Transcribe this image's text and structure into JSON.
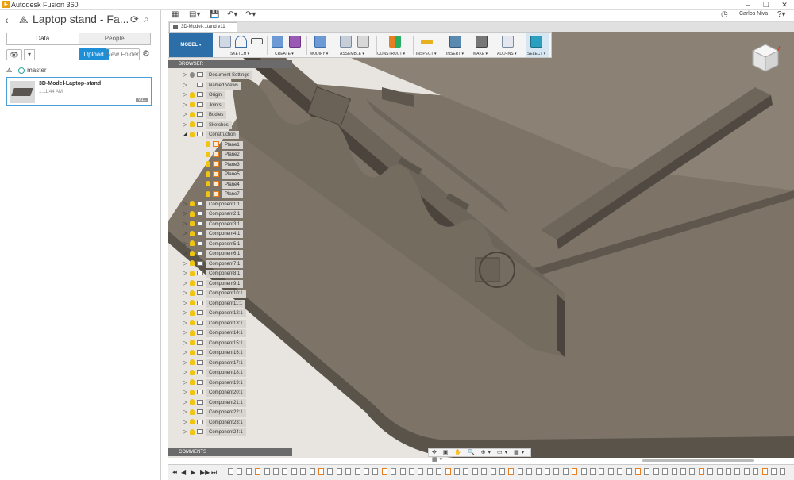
{
  "window": {
    "app_title": "Autodesk Fusion 360",
    "logo": "F",
    "min_glyph": "–",
    "max_glyph": "❐",
    "close_glyph": "✕"
  },
  "data_panel": {
    "title": "Laptop stand - Fa...",
    "tabs": [
      "Data",
      "People"
    ],
    "upload_label": "Upload",
    "new_folder_label": "New Folder",
    "branch": "master",
    "file": {
      "name": "3D-Model-Laptop-stand",
      "time": "1:11:44 AM",
      "version": "V11"
    }
  },
  "appbar": {
    "user": "Carlos Niva"
  },
  "doc_tab": {
    "label": "3D-Model-...tand v11"
  },
  "toolbar": {
    "mode": "MODEL",
    "groups": [
      "SKETCH",
      "CREATE",
      "MODIFY",
      "ASSEMBLE",
      "CONSTRUCT",
      "INSPECT",
      "INSERT",
      "MAKE",
      "ADD-INS",
      "SELECT"
    ]
  },
  "browser": {
    "header": "BROWSER",
    "items": [
      {
        "label": "Document Settings"
      },
      {
        "label": "Named Views"
      },
      {
        "label": "Origin"
      },
      {
        "label": "Joints"
      },
      {
        "label": "Bodies"
      },
      {
        "label": "Sketches"
      },
      {
        "label": "Construction"
      },
      {
        "label": "Plane1"
      },
      {
        "label": "Plane2"
      },
      {
        "label": "Plane3"
      },
      {
        "label": "Plane5"
      },
      {
        "label": "Plane4"
      },
      {
        "label": "Plane7"
      },
      {
        "label": "Component1:1"
      },
      {
        "label": "Component2:1"
      },
      {
        "label": "Component3:1"
      },
      {
        "label": "Component4:1"
      },
      {
        "label": "Component5:1"
      },
      {
        "label": "Component6:1"
      },
      {
        "label": "Component7:1"
      },
      {
        "label": "Component8:1"
      },
      {
        "label": "Component9:1"
      },
      {
        "label": "Component10:1"
      },
      {
        "label": "Component11:1"
      },
      {
        "label": "Component12:1"
      },
      {
        "label": "Component13:1"
      },
      {
        "label": "Component14:1"
      },
      {
        "label": "Component15:1"
      },
      {
        "label": "Component16:1"
      },
      {
        "label": "Component17:1"
      },
      {
        "label": "Component18:1"
      },
      {
        "label": "Component19:1"
      },
      {
        "label": "Component20:1"
      },
      {
        "label": "Component21:1"
      },
      {
        "label": "Component22:1"
      },
      {
        "label": "Component23:1"
      },
      {
        "label": "Component24:1"
      }
    ]
  },
  "comments": {
    "label": "COMMENTS"
  },
  "nav_glyphs": "✥ ▣ ✋ 🔍 ⊕▾ ▭▾ ▦▾ ▦▾",
  "timeline": {
    "controls": [
      "⏮",
      "◀",
      "▶",
      "▶▶",
      "⏭"
    ]
  }
}
